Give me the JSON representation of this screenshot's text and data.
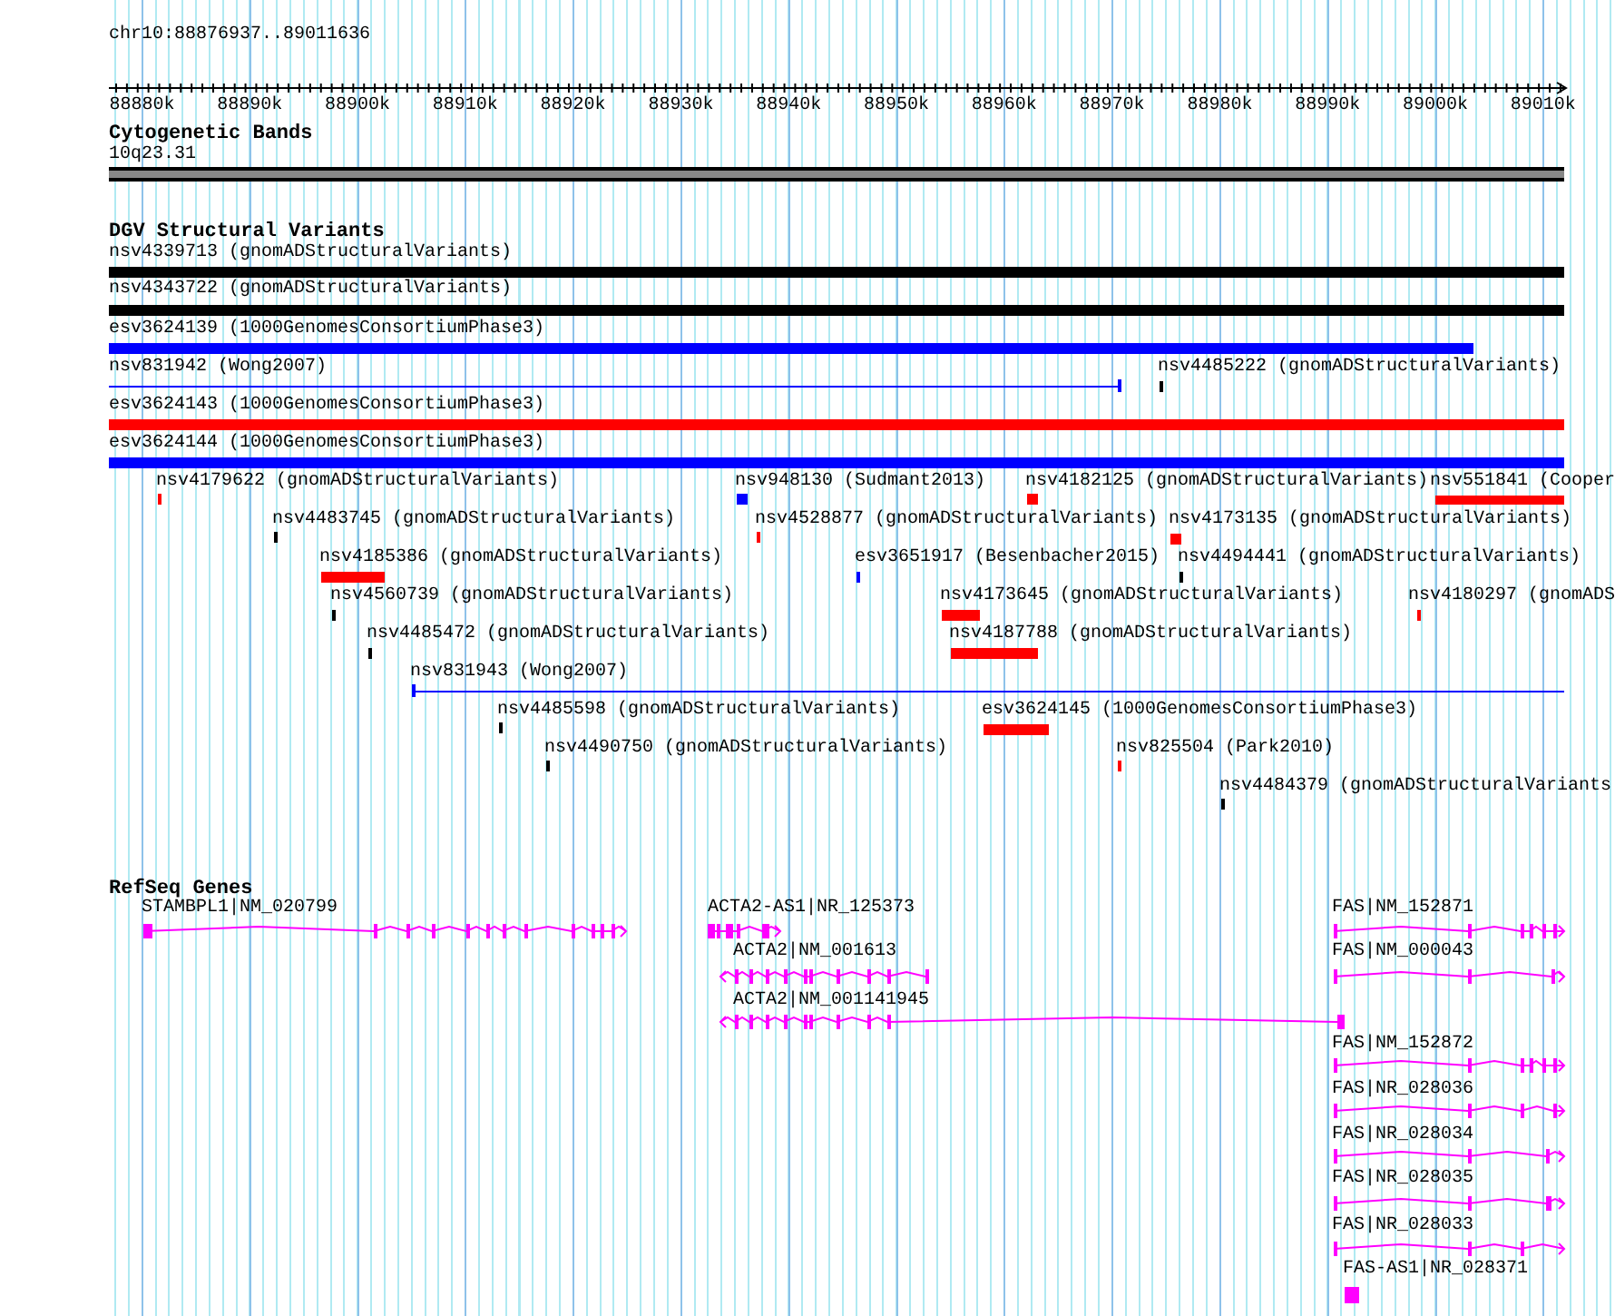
{
  "ruler": {
    "position": "chr10:88876937..89011636",
    "ticks": [
      "88880k",
      "88890k",
      "88900k",
      "88910k",
      "88920k",
      "88930k",
      "88940k",
      "88950k",
      "88960k",
      "88970k",
      "88980k",
      "88990k",
      "89000k",
      "89010k"
    ]
  },
  "cytobands": {
    "title": "Cytogenetic Bands",
    "bands": [
      {
        "label": "10q23.31"
      }
    ]
  },
  "variants": {
    "title": "DGV Structural Variants",
    "features": [
      {
        "kind": "bar",
        "label": "nsv4339713 (gnomADStructuralVariants)",
        "color": "#000000"
      },
      {
        "kind": "bar",
        "label": "nsv4343722 (gnomADStructuralVariants)",
        "color": "#000000"
      },
      {
        "kind": "bar",
        "label": "esv3624139 (1000GenomesConsortiumPhase3)",
        "color": "#0000ff"
      },
      {
        "kind": "line",
        "label": "nsv831942 (Wong2007)",
        "color": "#0000ff"
      },
      {
        "kind": "bar",
        "label": "nsv4485222 (gnomADStructuralVariants)",
        "color": "#000000"
      },
      {
        "kind": "bar",
        "label": "esv3624143 (1000GenomesConsortiumPhase3)",
        "color": "#ff0000"
      },
      {
        "kind": "bar",
        "label": "esv3624144 (1000GenomesConsortiumPhase3)",
        "color": "#0000ff"
      },
      {
        "kind": "bar",
        "label": "nsv4179622 (gnomADStructuralVariants)",
        "color": "#ff0000"
      },
      {
        "kind": "bar",
        "label": "nsv948130 (Sudmant2013)",
        "color": "#0000ff"
      },
      {
        "kind": "bar",
        "label": "nsv4182125 (gnomADStructuralVariants)",
        "color": "#ff0000"
      },
      {
        "kind": "bar",
        "label": "nsv551841 (Cooper",
        "color": "#ff0000"
      },
      {
        "kind": "bar",
        "label": "nsv4483745 (gnomADStructuralVariants)",
        "color": "#000000"
      },
      {
        "kind": "bar",
        "label": "nsv4528877 (gnomADStructuralVariants)",
        "color": "#ff0000"
      },
      {
        "kind": "bar",
        "label": "nsv4173135 (gnomADStructuralVariants)",
        "color": "#ff0000"
      },
      {
        "kind": "bar",
        "label": "nsv4185386 (gnomADStructuralVariants)",
        "color": "#ff0000"
      },
      {
        "kind": "bar",
        "label": "esv3651917 (Besenbacher2015)",
        "color": "#0000ff"
      },
      {
        "kind": "bar",
        "label": "nsv4494441 (gnomADStructuralVariants)",
        "color": "#000000"
      },
      {
        "kind": "bar",
        "label": "nsv4560739 (gnomADStructuralVariants)",
        "color": "#000000"
      },
      {
        "kind": "bar",
        "label": "nsv4173645 (gnomADStructuralVariants)",
        "color": "#ff0000"
      },
      {
        "kind": "bar",
        "label": "nsv4180297 (gnomADS",
        "color": "#ff0000"
      },
      {
        "kind": "bar",
        "label": "nsv4485472 (gnomADStructuralVariants)",
        "color": "#000000"
      },
      {
        "kind": "bar",
        "label": "nsv4187788 (gnomADStructuralVariants)",
        "color": "#ff0000"
      },
      {
        "kind": "line",
        "label": "nsv831943 (Wong2007)",
        "color": "#0000ff"
      },
      {
        "kind": "bar",
        "label": "nsv4485598 (gnomADStructuralVariants)",
        "color": "#000000"
      },
      {
        "kind": "bar",
        "label": "esv3624145 (1000GenomesConsortiumPhase3)",
        "color": "#ff0000"
      },
      {
        "kind": "bar",
        "label": "nsv4490750 (gnomADStructuralVariants)",
        "color": "#000000"
      },
      {
        "kind": "bar",
        "label": "nsv825504 (Park2010)",
        "color": "#ff0000"
      },
      {
        "kind": "bar",
        "label": "nsv4484379 (gnomADStructuralVariants",
        "color": "#000000"
      }
    ]
  },
  "genes": {
    "title": "RefSeq Genes",
    "features": [
      {
        "kind": "transcript",
        "label": "STAMBPL1|NM_020799"
      },
      {
        "kind": "transcript",
        "label": "ACTA2-AS1|NR_125373"
      },
      {
        "kind": "transcript",
        "label": "ACTA2|NM_001613"
      },
      {
        "kind": "transcript",
        "label": "ACTA2|NM_001141945"
      },
      {
        "kind": "transcript",
        "label": "FAS|NM_152871"
      },
      {
        "kind": "transcript",
        "label": "FAS|NM_000043"
      },
      {
        "kind": "transcript",
        "label": "FAS|NM_152872"
      },
      {
        "kind": "transcript",
        "label": "FAS|NR_028036"
      },
      {
        "kind": "transcript",
        "label": "FAS|NR_028034"
      },
      {
        "kind": "transcript",
        "label": "FAS|NR_028035"
      },
      {
        "kind": "transcript",
        "label": "FAS|NR_028033"
      },
      {
        "kind": "block",
        "label": "FAS-AS1|NR_028371"
      }
    ]
  }
}
